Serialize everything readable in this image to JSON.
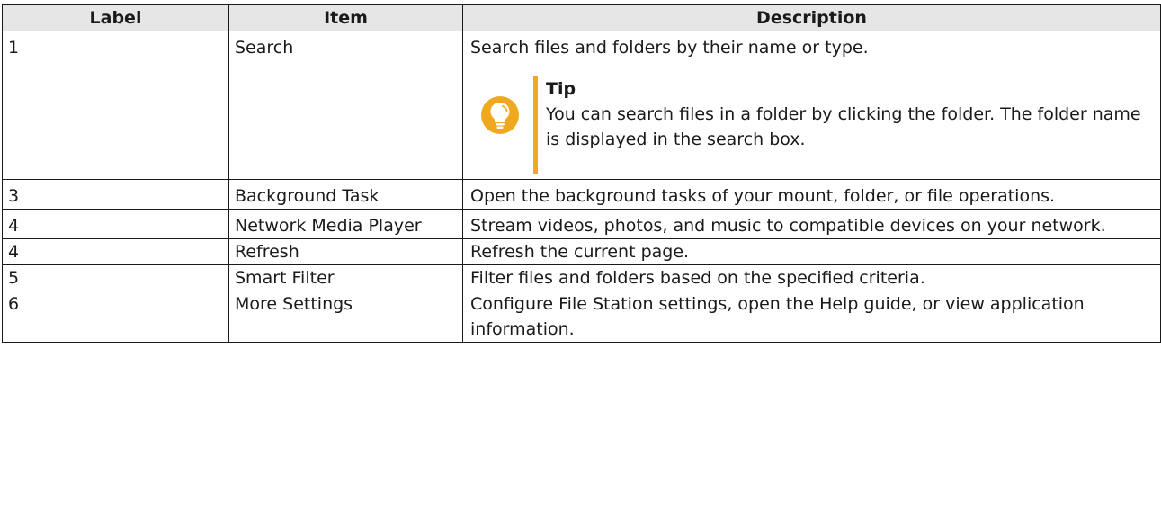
{
  "table": {
    "headers": {
      "label": "Label",
      "item": "Item",
      "description": "Description"
    },
    "rows": [
      {
        "label": "1",
        "item": "Search",
        "description": "Search files and folders by their name or type.",
        "tip": {
          "title": "Tip",
          "icon": "lightbulb-icon",
          "text": "You can search files in a folder by clicking the folder. The folder name is displayed in the search box."
        }
      },
      {
        "label": "3",
        "item": "Background Task",
        "description": "Open the background tasks of your mount, folder, or file operations."
      },
      {
        "label": "4",
        "item": "Network Media Player",
        "description": "Stream videos, photos, and music to compatible devices on your network."
      },
      {
        "label": "4",
        "item": "Refresh",
        "description": "Refresh the current page."
      },
      {
        "label": "5",
        "item": "Smart Filter",
        "description": "Filter files and folders based on the specified criteria."
      },
      {
        "label": "6",
        "item": "More Settings",
        "description": "Configure File Station settings, open the Help guide, or view application information."
      }
    ]
  },
  "colors": {
    "header_bg": "#e6e6e6",
    "tip_accent": "#f0a81f",
    "border": "#1a1a1a"
  }
}
